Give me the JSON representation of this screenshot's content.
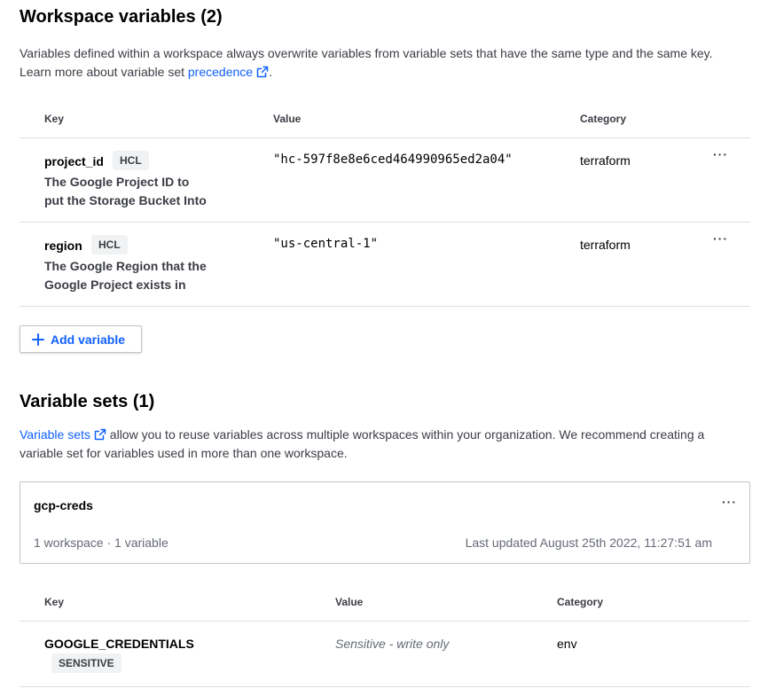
{
  "workspace_variables": {
    "title": "Workspace variables (2)",
    "description_line1": "Variables defined within a workspace always overwrite variables from variable sets that have the same type and the same key.",
    "description_line2_prefix": "Learn more about variable set ",
    "description_link": "precedence",
    "description_suffix": ".",
    "columns": {
      "key": "Key",
      "value": "Value",
      "category": "Category"
    },
    "rows": [
      {
        "key": "project_id",
        "badge": "HCL",
        "description_line1": "The Google Project ID to",
        "description_line2": "put the Storage Bucket Into",
        "value": "\"hc-597f8e8e6ced464990965ed2a04\"",
        "category": "terraform",
        "menu": "···"
      },
      {
        "key": "region",
        "badge": "HCL",
        "description_line1": "The Google Region that the",
        "description_line2": "Google Project exists in",
        "value": "\"us-central-1\"",
        "category": "terraform",
        "menu": "···"
      }
    ],
    "add_button_label": "Add variable"
  },
  "variable_sets": {
    "title": "Variable sets (1)",
    "description_link": "Variable sets",
    "description_line1_rest": " allow you to reuse variables across multiple workspaces within your organization. We recommend creating a",
    "description_line2": "variable set for variables used in more than one workspace.",
    "card": {
      "name": "gcp-creds",
      "meta": "1 workspace · 1 variable",
      "updated": "Last updated August 25th 2022, 11:27:51 am",
      "menu": "···"
    },
    "columns": {
      "key": "Key",
      "value": "Value",
      "category": "Category"
    },
    "rows": [
      {
        "key": "GOOGLE_CREDENTIALS",
        "badge": "SENSITIVE",
        "value": "Sensitive - write only",
        "category": "env"
      }
    ]
  },
  "colors": {
    "link": "#1060ff",
    "text_secondary": "#3b3d45",
    "badge_bg": "#f1f2f3",
    "divider": "#dcdfe4"
  },
  "icons": {
    "external_link": "external-link-icon",
    "plus": "plus-icon",
    "menu": "ellipsis-icon"
  }
}
